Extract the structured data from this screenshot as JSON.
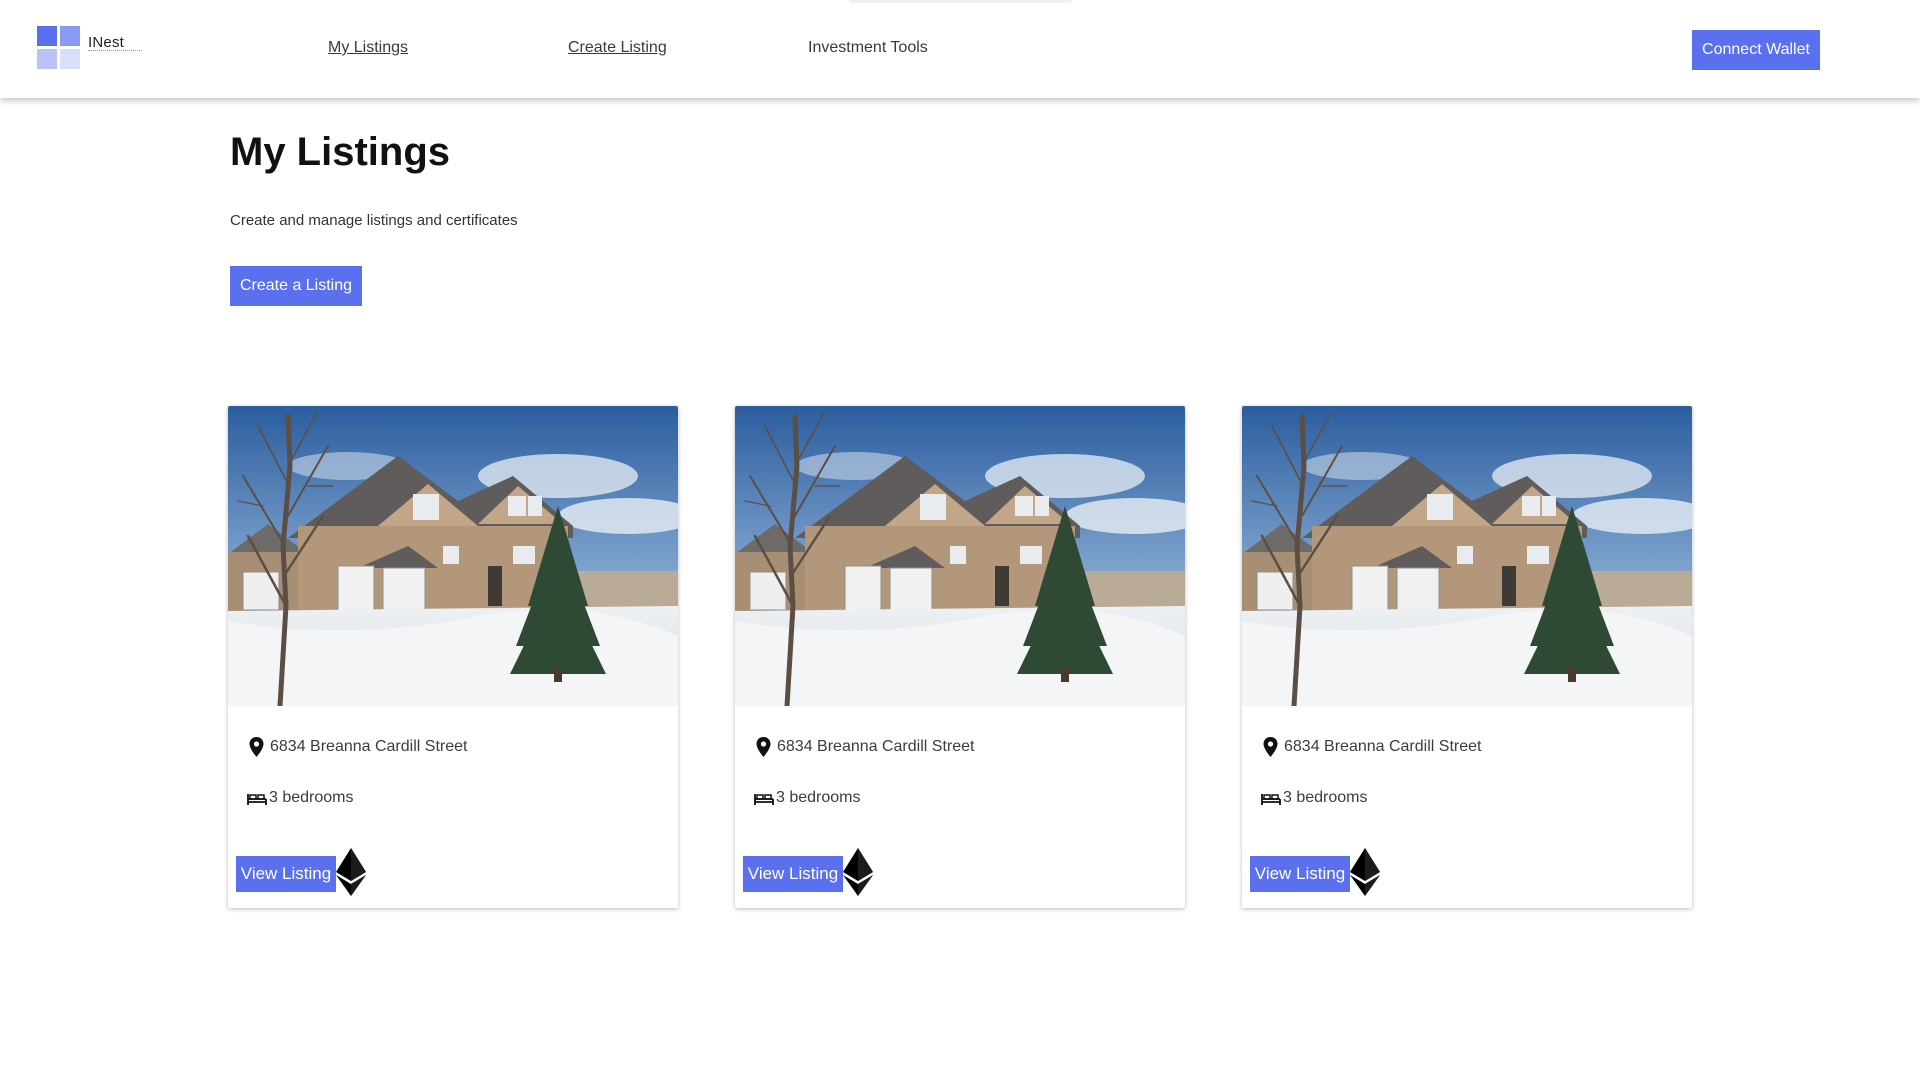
{
  "header": {
    "logo_text": "INest",
    "nav": [
      {
        "label": "My Listings",
        "underlined": true
      },
      {
        "label": "Create Listing",
        "underlined": true
      },
      {
        "label": "Investment Tools",
        "underlined": false
      }
    ],
    "connect_label": "Connect Wallet"
  },
  "main": {
    "title": "My Listings",
    "subtitle": "Create and manage listings and certificates",
    "create_label": "Create a Listing"
  },
  "listings": [
    {
      "address": "6834 Breanna Cardill Street",
      "bedrooms": "3 bedrooms",
      "view_label": "View Listing",
      "currency_icon": "ethereum-icon"
    },
    {
      "address": "6834 Breanna Cardill Street",
      "bedrooms": "3 bedrooms",
      "view_label": "View Listing",
      "currency_icon": "ethereum-icon"
    },
    {
      "address": "6834 Breanna Cardill Street",
      "bedrooms": "3 bedrooms",
      "view_label": "View Listing",
      "currency_icon": "ethereum-icon"
    }
  ],
  "icons": {
    "address": "location-pin-icon",
    "bedrooms": "bed-icon",
    "currency": "ethereum-icon"
  },
  "colors": {
    "accent": "#5a70ee",
    "header_bg": "#ffffff",
    "page_bg": "#ffffff"
  }
}
